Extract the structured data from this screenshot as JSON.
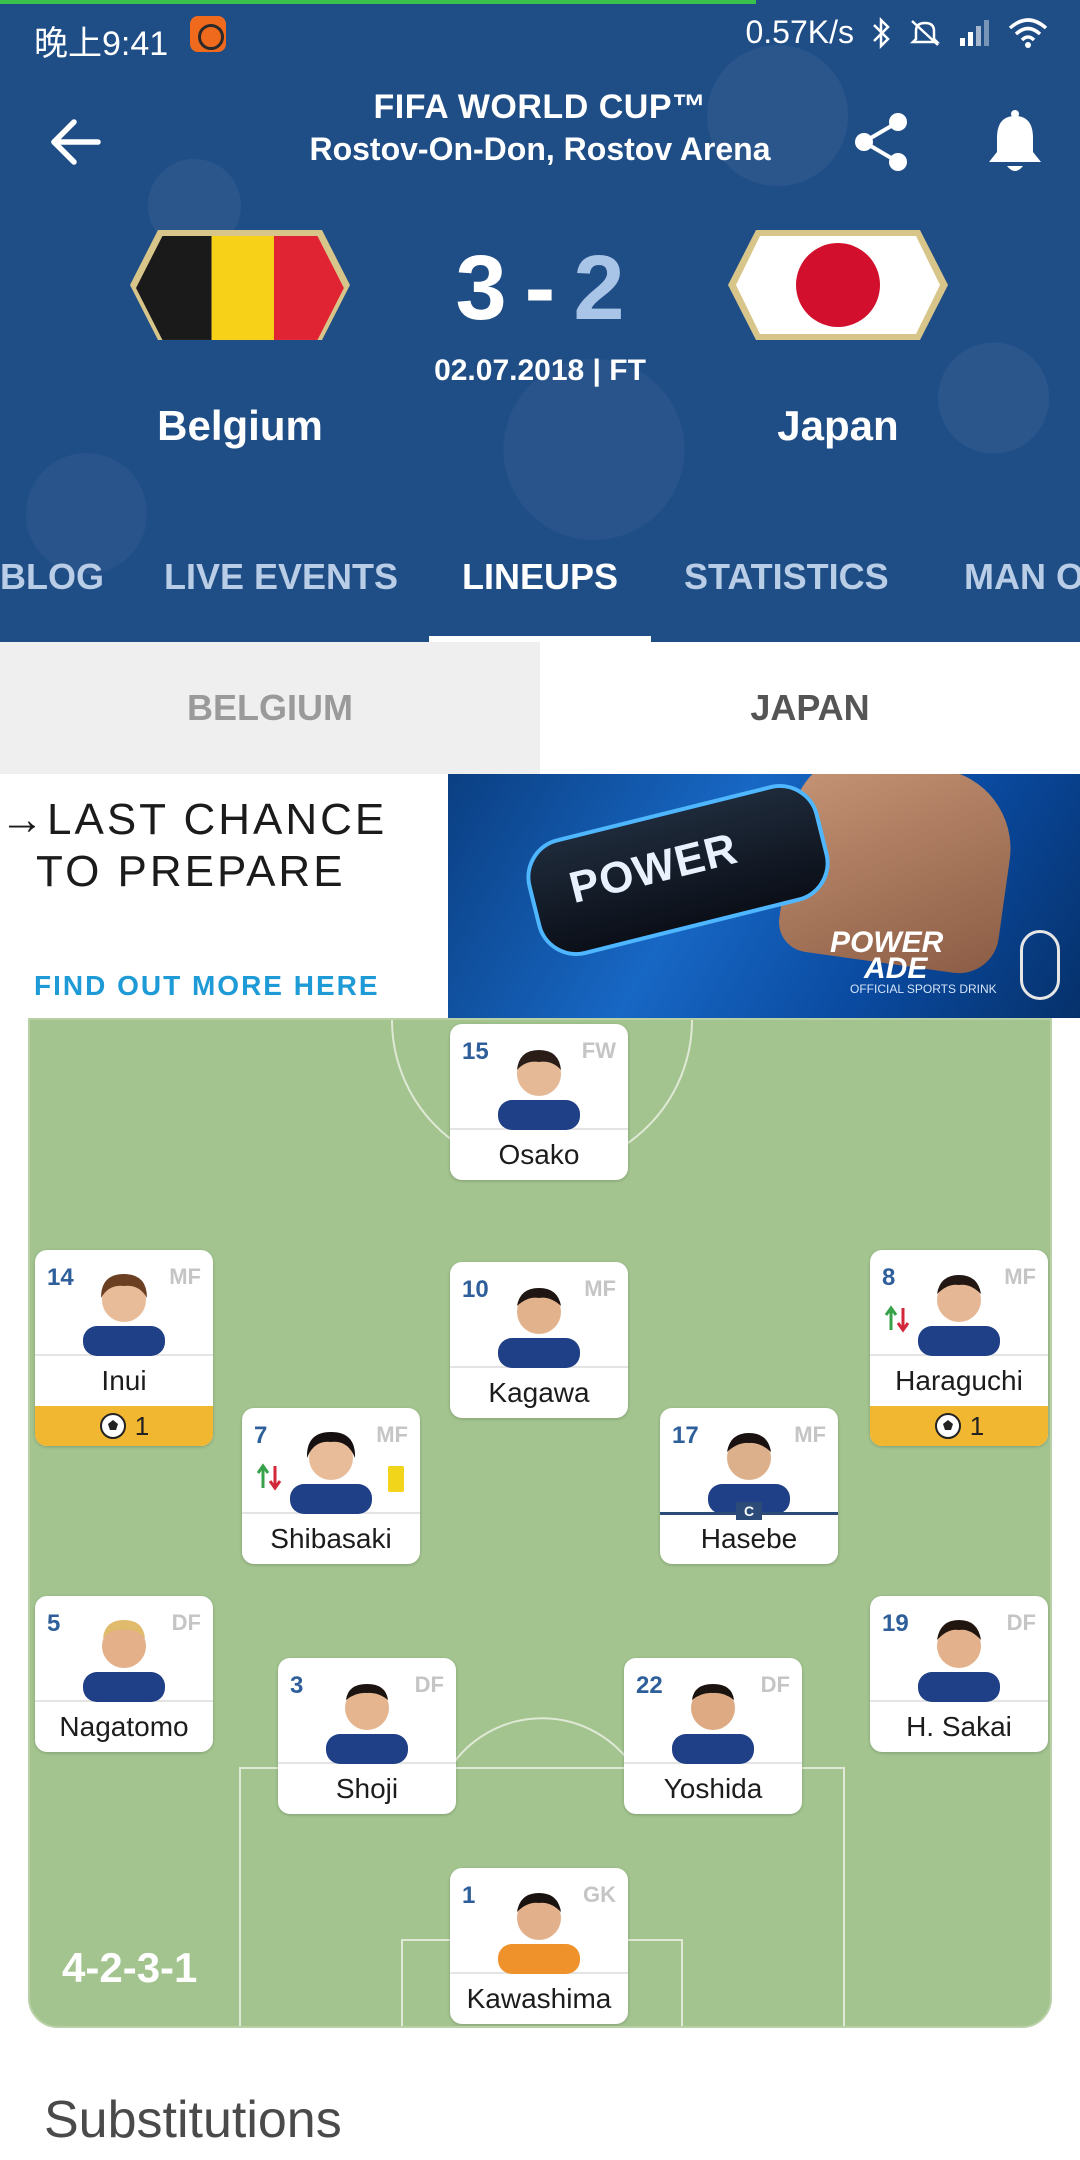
{
  "status_bar": {
    "time": "晚上9:41",
    "network_speed": "0.57K/s"
  },
  "page_progress": 0.7,
  "header": {
    "title": "FIFA WORLD CUP™",
    "venue": "Rostov-On-Don, Rostov Arena",
    "home_team": "Belgium",
    "away_team": "Japan",
    "home_score": "3",
    "away_score": "2",
    "score_separator": "-",
    "date_status": "02.07.2018 | FT",
    "flags": {
      "home_colors": [
        "#1a1a1a",
        "#f7d117",
        "#e02433"
      ],
      "away_disc_color": "#d2102d"
    },
    "accent_color": "#1f4d86"
  },
  "tabs": [
    {
      "label": "BLOG",
      "active": false
    },
    {
      "label": "LIVE EVENTS",
      "active": false
    },
    {
      "label": "LINEUPS",
      "active": true
    },
    {
      "label": "STATISTICS",
      "active": false
    },
    {
      "label": "MAN O",
      "active": false
    }
  ],
  "team_toggle": {
    "home_label": "BELGIUM",
    "away_label": "JAPAN",
    "selected": "JAPAN"
  },
  "ad": {
    "line1": "→LAST CHANCE",
    "line2": "TO PREPARE",
    "cta": "FIND OUT MORE HERE",
    "bottle_label": "POWER",
    "brand_line1": "POWER",
    "brand_line2": "ADE",
    "brand_sub": "OFFICIAL SPORTS DRINK"
  },
  "lineup": {
    "formation": "4-2-3-1",
    "players": [
      {
        "number": "15",
        "position": "FW",
        "name": "Osako"
      },
      {
        "number": "14",
        "position": "MF",
        "name": "Inui",
        "goals": "1"
      },
      {
        "number": "10",
        "position": "MF",
        "name": "Kagawa"
      },
      {
        "number": "8",
        "position": "MF",
        "name": "Haraguchi",
        "goals": "1",
        "substituted": true
      },
      {
        "number": "7",
        "position": "MF",
        "name": "Shibasaki",
        "substituted": true,
        "yellow_card": true
      },
      {
        "number": "17",
        "position": "MF",
        "name": "Hasebe",
        "captain": true,
        "captain_badge": "C"
      },
      {
        "number": "5",
        "position": "DF",
        "name": "Nagatomo"
      },
      {
        "number": "3",
        "position": "DF",
        "name": "Shoji"
      },
      {
        "number": "22",
        "position": "DF",
        "name": "Yoshida"
      },
      {
        "number": "19",
        "position": "DF",
        "name": "H. Sakai"
      },
      {
        "number": "1",
        "position": "GK",
        "name": "Kawashima"
      }
    ]
  },
  "substitutions": {
    "title": "Substitutions"
  },
  "icons": {
    "back": "arrow-left-icon",
    "share": "share-icon",
    "bell": "bell-icon",
    "goal": "soccer-ball-icon",
    "sub": "substitution-arrows-icon"
  }
}
